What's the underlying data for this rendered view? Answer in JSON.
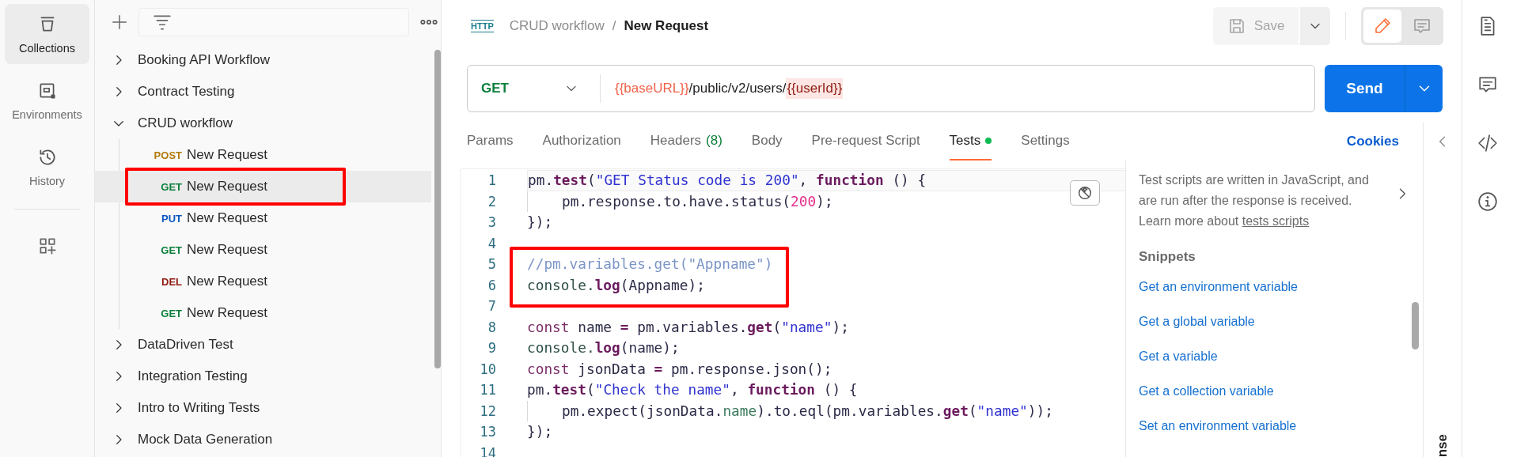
{
  "rail": {
    "items": [
      {
        "kind": "collections",
        "label": "Collections",
        "selected": true
      },
      {
        "kind": "environments",
        "label": "Environments",
        "selected": false
      },
      {
        "kind": "history",
        "label": "History",
        "selected": false
      }
    ]
  },
  "sidebar": {
    "items": [
      {
        "label": "Booking API Workflow",
        "expanded": false
      },
      {
        "label": "Contract Testing",
        "expanded": false
      },
      {
        "label": "CRUD workflow",
        "expanded": true,
        "children": [
          {
            "method": "POST",
            "color": "#b0790a",
            "label": "New Request",
            "selected": false,
            "boxed": false
          },
          {
            "method": "GET",
            "color": "#0b7f3b",
            "label": "New Request",
            "selected": true,
            "boxed": true
          },
          {
            "method": "PUT",
            "color": "#0b57c1",
            "label": "New Request",
            "selected": false,
            "boxed": false
          },
          {
            "method": "GET",
            "color": "#0b7f3b",
            "label": "New Request",
            "selected": false,
            "boxed": false
          },
          {
            "method": "DEL",
            "color": "#8e1a10",
            "label": "New Request",
            "selected": false,
            "boxed": false
          },
          {
            "method": "GET",
            "color": "#0b7f3b",
            "label": "New Request",
            "selected": false,
            "boxed": false
          }
        ]
      },
      {
        "label": "DataDriven Test",
        "expanded": false
      },
      {
        "label": "Integration Testing",
        "expanded": false
      },
      {
        "label": "Intro to Writing Tests",
        "expanded": false
      },
      {
        "label": "Mock Data Generation",
        "expanded": false
      }
    ]
  },
  "header": {
    "icon_text": "HTTP",
    "parent": "CRUD workflow",
    "separator": "/",
    "title": "New Request",
    "save": {
      "label": "Save",
      "disabled": true
    },
    "modes": [
      {
        "kind": "edit",
        "selected": true
      },
      {
        "kind": "comments",
        "selected": false
      }
    ]
  },
  "request": {
    "method": "GET",
    "url": [
      {
        "kind": "variable",
        "text": "{{baseURL}}"
      },
      {
        "kind": "plain",
        "text": "/public/v2/users/"
      },
      {
        "kind": "unresolved",
        "text": "{{userId}}"
      }
    ],
    "send": "Send"
  },
  "tabs": [
    {
      "label": "Params",
      "selected": false,
      "has_content": false
    },
    {
      "label": "Authorization",
      "selected": false,
      "has_content": false
    },
    {
      "label": "Headers",
      "count": "(8)",
      "selected": false,
      "has_content": false
    },
    {
      "label": "Body",
      "selected": false,
      "has_content": false
    },
    {
      "label": "Pre-request Script",
      "selected": false,
      "has_content": false
    },
    {
      "label": "Tests",
      "selected": true,
      "has_content": true
    },
    {
      "label": "Settings",
      "selected": false,
      "has_content": false
    }
  ],
  "cookies": "Cookies",
  "editor": {
    "lines": [
      {
        "number": "1",
        "active": true,
        "boxed": false,
        "indented": false,
        "tokens": [
          {
            "kind": "plain",
            "text": "pm."
          },
          {
            "kind": "fn",
            "text": "test"
          },
          {
            "kind": "plain",
            "text": "("
          },
          {
            "kind": "string",
            "text": "\"GET Status code is 200\""
          },
          {
            "kind": "plain",
            "text": ", "
          },
          {
            "kind": "keyword",
            "text": "function"
          },
          {
            "kind": "plain",
            "text": " () {"
          }
        ]
      },
      {
        "number": "2",
        "active": false,
        "boxed": false,
        "indented": true,
        "tokens": [
          {
            "kind": "plain",
            "text": "pm.response.to.have.status("
          },
          {
            "kind": "number",
            "text": "200"
          },
          {
            "kind": "plain",
            "text": ");"
          }
        ]
      },
      {
        "number": "3",
        "active": false,
        "boxed": false,
        "indented": false,
        "tokens": [
          {
            "kind": "plain",
            "text": "});"
          }
        ]
      },
      {
        "number": "4",
        "active": false,
        "boxed": false
      },
      {
        "number": "5",
        "active": false,
        "boxed": true,
        "indented": false,
        "tokens": [
          {
            "kind": "comment",
            "text": "//pm.variables.get(\"Appname\")"
          }
        ]
      },
      {
        "number": "6",
        "active": false,
        "boxed": true,
        "indented": false,
        "tokens": [
          {
            "kind": "object",
            "text": "console."
          },
          {
            "kind": "fn",
            "text": "log"
          },
          {
            "kind": "plain",
            "text": "(Appname);"
          }
        ]
      },
      {
        "number": "7",
        "active": false,
        "boxed": true
      },
      {
        "number": "8",
        "active": false,
        "boxed": false,
        "indented": false,
        "tokens": [
          {
            "kind": "decl",
            "text": "const"
          },
          {
            "kind": "plain",
            "text": " name "
          },
          {
            "kind": "fn",
            "text": "="
          },
          {
            "kind": "plain",
            "text": " pm.variables."
          },
          {
            "kind": "fn",
            "text": "get"
          },
          {
            "kind": "plain",
            "text": "("
          },
          {
            "kind": "string",
            "text": "\"name\""
          },
          {
            "kind": "plain",
            "text": ");"
          }
        ]
      },
      {
        "number": "9",
        "active": false,
        "boxed": false,
        "indented": false,
        "tokens": [
          {
            "kind": "object",
            "text": "console."
          },
          {
            "kind": "fn",
            "text": "log"
          },
          {
            "kind": "plain",
            "text": "(name);"
          }
        ]
      },
      {
        "number": "10",
        "active": false,
        "boxed": false,
        "indented": false,
        "tokens": [
          {
            "kind": "decl",
            "text": "const"
          },
          {
            "kind": "plain",
            "text": " jsonData "
          },
          {
            "kind": "fn",
            "text": "="
          },
          {
            "kind": "plain",
            "text": " pm.response.json();"
          }
        ]
      },
      {
        "number": "11",
        "active": false,
        "boxed": false,
        "indented": false,
        "tokens": [
          {
            "kind": "plain",
            "text": "pm."
          },
          {
            "kind": "fn",
            "text": "test"
          },
          {
            "kind": "plain",
            "text": "("
          },
          {
            "kind": "string",
            "text": "\"Check the name\""
          },
          {
            "kind": "plain",
            "text": ", "
          },
          {
            "kind": "keyword",
            "text": "function"
          },
          {
            "kind": "plain",
            "text": " () {"
          }
        ]
      },
      {
        "number": "12",
        "active": false,
        "boxed": false,
        "indented": true,
        "tokens": [
          {
            "kind": "plain",
            "text": "pm.expect(jsonData."
          },
          {
            "kind": "property",
            "text": "name"
          },
          {
            "kind": "plain",
            "text": ").to.eql(pm.variables."
          },
          {
            "kind": "fn",
            "text": "get"
          },
          {
            "kind": "plain",
            "text": "("
          },
          {
            "kind": "string",
            "text": "\"name\""
          },
          {
            "kind": "plain",
            "text": "));"
          }
        ]
      },
      {
        "number": "13",
        "active": false,
        "boxed": false,
        "indented": false,
        "tokens": [
          {
            "kind": "plain",
            "text": "});"
          }
        ]
      },
      {
        "number": "14",
        "active": false,
        "boxed": false
      }
    ]
  },
  "help": {
    "text": "Test scripts are written in JavaScript, and are run after the response is received. Learn more about",
    "link": "tests scripts",
    "snippets_title": "Snippets",
    "snippets": [
      "Get an environment variable",
      "Get a global variable",
      "Get a variable",
      "Get a collection variable",
      "Set an environment variable"
    ]
  },
  "response_pane": {
    "label": "nse"
  }
}
